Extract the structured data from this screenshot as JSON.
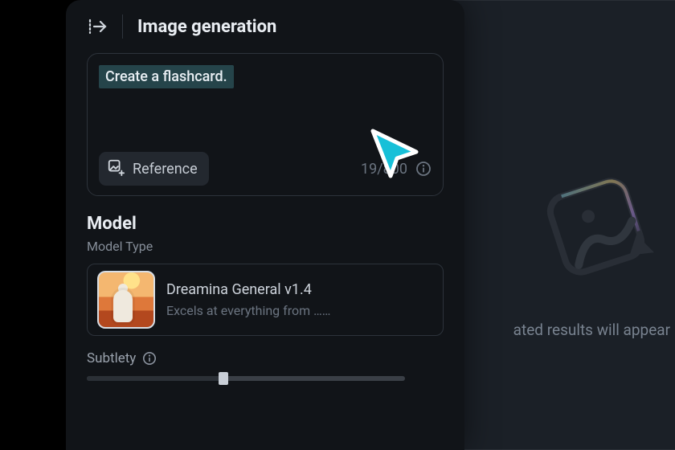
{
  "header": {
    "title": "Image generation"
  },
  "prompt": {
    "text": "Create a flashcard.",
    "reference_button": "Reference",
    "char_count": "19/800"
  },
  "model": {
    "section_title": "Model",
    "type_label": "Model Type",
    "name": "Dreamina General v1.4",
    "description": "Excels at everything from ……"
  },
  "subtlety": {
    "label": "Subtlety"
  },
  "output": {
    "placeholder_text": "ated results will appear he"
  },
  "colors": {
    "panel_bg": "#111418",
    "accent_cyan": "#17c0d8"
  }
}
